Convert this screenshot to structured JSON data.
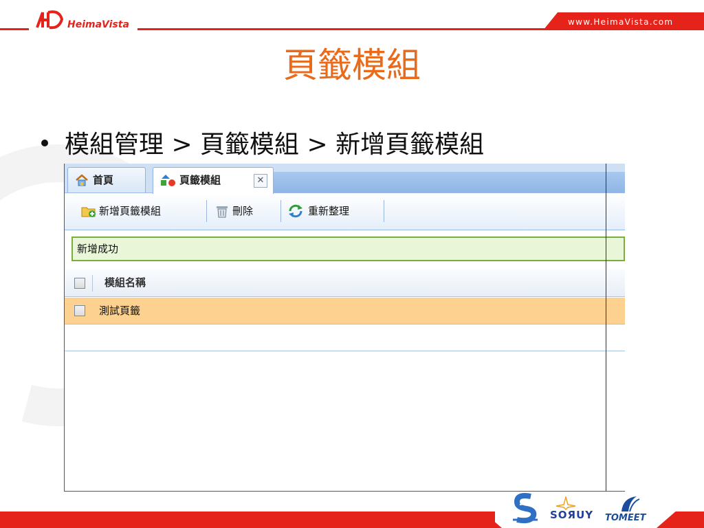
{
  "header": {
    "logo_text": "HeimaVista",
    "url": "www.HeimaVista.com",
    "accent": "#e5231b"
  },
  "slide": {
    "title": "頁籤模組",
    "title_color": "#e86a1a",
    "breadcrumb": "模組管理 > 頁籤模組 > 新增頁籤模組"
  },
  "app": {
    "tabs": [
      {
        "label": "首頁",
        "icon": "home-icon"
      },
      {
        "label": "頁籤模組",
        "icon": "module-icon",
        "close": "✕"
      }
    ],
    "toolbar": {
      "add_label": "新增頁籤模組",
      "delete_label": "刪除",
      "refresh_label": "重新整理"
    },
    "message": "新增成功",
    "grid": {
      "column": "模組名稱",
      "rows": [
        "測試頁籤"
      ]
    }
  },
  "footer": {
    "partners": [
      "SOЯUY",
      "TOMEET"
    ]
  }
}
